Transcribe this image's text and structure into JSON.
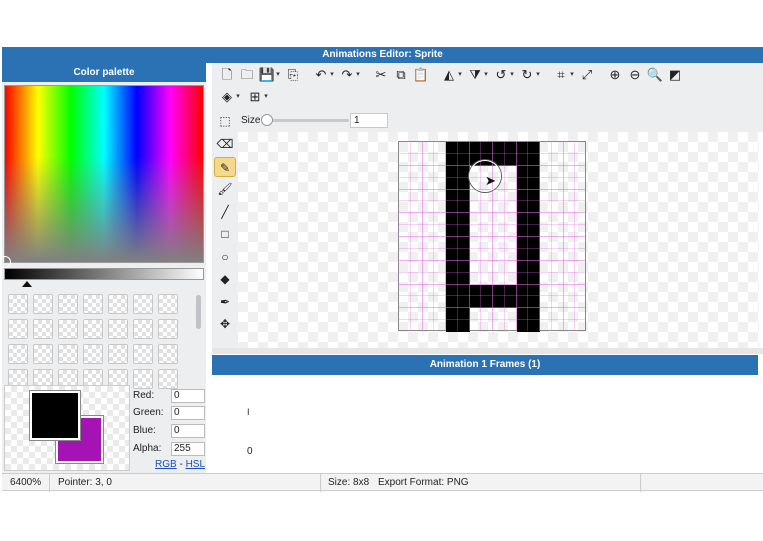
{
  "window": {
    "title": "Animations Editor: Sprite"
  },
  "color_palette": {
    "title": "Color palette",
    "labels": {
      "red": "Red:",
      "green": "Green:",
      "blue": "Blue:",
      "alpha": "Alpha:"
    },
    "values": {
      "red": "0",
      "green": "0",
      "blue": "0",
      "alpha": "255"
    },
    "links": {
      "rgb": "RGB",
      "sep": " - ",
      "hsl": "HSL"
    },
    "foreground_color": "#000000",
    "background_color": "#a414b4"
  },
  "toolbar": {
    "row1": [
      {
        "name": "new-file-icon",
        "glyph": "🗋"
      },
      {
        "name": "open-folder-icon",
        "glyph": "🗀"
      },
      {
        "name": "save-icon",
        "glyph": "💾",
        "caret": true
      },
      {
        "name": "import-icon",
        "glyph": "⎘"
      },
      {
        "name": "undo-icon",
        "glyph": "↶",
        "caret": true
      },
      {
        "name": "redo-icon",
        "glyph": "↷",
        "caret": true
      },
      {
        "name": "cut-icon",
        "glyph": "✂"
      },
      {
        "name": "copy-icon",
        "glyph": "⧉"
      },
      {
        "name": "paste-icon",
        "glyph": "📋"
      },
      {
        "name": "flip-horizontal-icon",
        "glyph": "◭",
        "caret": true
      },
      {
        "name": "flip-vertical-icon",
        "glyph": "⧩",
        "caret": true
      },
      {
        "name": "rotate-left-icon",
        "glyph": "↺",
        "caret": true
      },
      {
        "name": "rotate-right-icon",
        "glyph": "↻",
        "caret": true
      },
      {
        "name": "crop-icon",
        "glyph": "⌗",
        "caret": true
      },
      {
        "name": "resize-icon",
        "glyph": "⤢"
      },
      {
        "name": "zoom-in-icon",
        "glyph": "⊕"
      },
      {
        "name": "zoom-out-icon",
        "glyph": "⊖"
      },
      {
        "name": "zoom-fit-icon",
        "glyph": "🔍"
      },
      {
        "name": "transparency-icon",
        "glyph": "◩"
      }
    ],
    "row2": [
      {
        "name": "layers-icon",
        "glyph": "◈",
        "caret": true
      },
      {
        "name": "grid-icon",
        "glyph": "⊞",
        "caret": true
      }
    ],
    "size_label": "Size",
    "size_value": "1",
    "size_slider_fraction": 0
  },
  "tools": [
    {
      "name": "eraser-tool-icon",
      "glyph": "⌫",
      "active": false
    },
    {
      "name": "pencil-tool-icon",
      "glyph": "✎",
      "active": true
    },
    {
      "name": "brush-tool-icon",
      "glyph": "🖌",
      "active": false
    },
    {
      "name": "line-tool-icon",
      "glyph": "╱",
      "active": false
    },
    {
      "name": "rectangle-tool-icon",
      "glyph": "□",
      "active": false
    },
    {
      "name": "ellipse-tool-icon",
      "glyph": "○",
      "active": false
    },
    {
      "name": "fill-tool-icon",
      "glyph": "◆",
      "active": false
    },
    {
      "name": "eyedropper-tool-icon",
      "glyph": "✒",
      "active": false
    },
    {
      "name": "move-tool-icon",
      "glyph": "✥",
      "active": false
    }
  ],
  "sprite": {
    "grid_size": 8,
    "pixels": [
      "..XXXX..",
      "..X..X..",
      "..X..X..",
      "..X..X..",
      "..X..X..",
      "..X..X..",
      "..XXXX..",
      "..X..X.."
    ],
    "pixel_color": "#000000",
    "grid_color": "#e76be0"
  },
  "frames": {
    "title": "Animation 1 Frames (1)",
    "frame_marker": "I",
    "frame_index": "0"
  },
  "status": {
    "zoom": "6400%",
    "pointer": "Pointer: 3, 0",
    "size": "Size: 8x8",
    "export": "Export Format: PNG"
  }
}
